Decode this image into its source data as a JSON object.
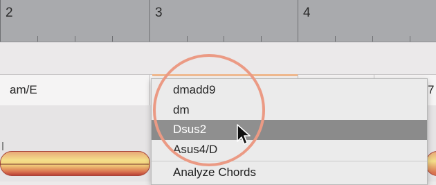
{
  "ruler": {
    "bars": [
      "2",
      "3",
      "4"
    ]
  },
  "chord_lane": {
    "visible_chord": "am/E",
    "right_edge_partial": "7"
  },
  "context_menu": {
    "items": [
      {
        "label": "dmadd9",
        "selected": false
      },
      {
        "label": "dm",
        "selected": false
      },
      {
        "label": "Dsus2",
        "selected": true
      },
      {
        "label": "Asus4/D",
        "selected": false
      },
      {
        "label": "Analyze Chords",
        "selected": false
      }
    ]
  },
  "colors": {
    "ruler_bg": "#a9aaad",
    "selection": "#8b8b8b",
    "highlight_circle": "#eb9a84",
    "note_blob": "#f3d27c"
  },
  "icons": {
    "cursor": "arrow-pointer-icon"
  }
}
